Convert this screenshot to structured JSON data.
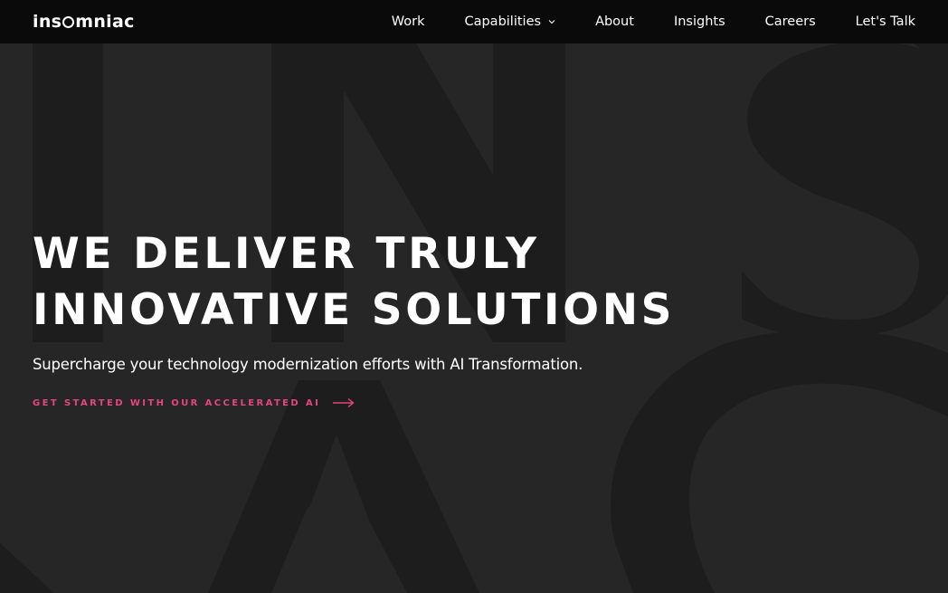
{
  "brand": {
    "logo_text_before": "ins",
    "logo_text_after": "mniac"
  },
  "nav": {
    "items": [
      {
        "label": "Work",
        "has_dropdown": false
      },
      {
        "label": "Capabilities",
        "has_dropdown": true
      },
      {
        "label": "About",
        "has_dropdown": false
      },
      {
        "label": "Insights",
        "has_dropdown": false
      },
      {
        "label": "Careers",
        "has_dropdown": false
      },
      {
        "label": "Let's Talk",
        "has_dropdown": false
      }
    ]
  },
  "hero": {
    "title_line1": "WE DELIVER TRULY",
    "title_line2": "INNOVATIVE SOLUTIONS",
    "subtitle": "Supercharge your technology modernization efforts with AI Transformation.",
    "cta_label": "GET STARTED WITH OUR ACCELERATED AI",
    "cta_icon": "arrow-right-icon"
  },
  "colors": {
    "background": "#262626",
    "navbar": "#0a0a0a",
    "accent": "#e6457f",
    "bg_letters": "#1c1c1c"
  }
}
